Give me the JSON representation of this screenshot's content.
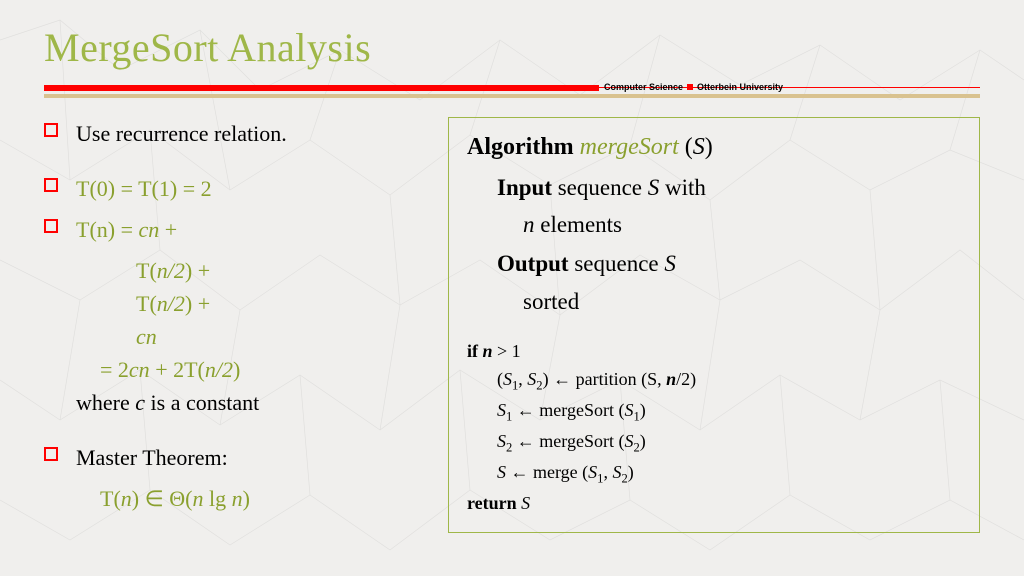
{
  "title": "MergeSort Analysis",
  "footer": {
    "left": "Computer Science",
    "right": "Otterbein University"
  },
  "bullets": {
    "b1": "Use recurrence relation.",
    "b2": "T(0) = T(1) = 2",
    "b3_l1_a": "T(n) = ",
    "b3_l1_b": "cn",
    "b3_l1_c": " +",
    "b3_l2_a": "T(",
    "b3_l2_b": "n/2",
    "b3_l2_c": ") +",
    "b3_l3_a": "T(",
    "b3_l3_b": "n/2",
    "b3_l3_c": ") +",
    "b3_l4": "cn",
    "b3_l5_a": "= 2",
    "b3_l5_b": "cn",
    "b3_l5_c": " + 2T(",
    "b3_l5_d": "n/2",
    "b3_l5_e": ")",
    "b3_where_a": "where ",
    "b3_where_b": "c",
    "b3_where_c": " is a constant",
    "b4": "Master Theorem:",
    "b4_sub_a": "T(",
    "b4_sub_b": "n",
    "b4_sub_c": ") ∈ Θ(",
    "b4_sub_d": "n",
    "b4_sub_e": " lg ",
    "b4_sub_f": "n",
    "b4_sub_g": ")"
  },
  "algo": {
    "kw": "Algorithm",
    "name": "mergeSort",
    "arg_open": " (",
    "arg": "S",
    "arg_close": ")",
    "input_kw": "Input",
    "input_a": " sequence ",
    "input_b": "S",
    "input_c": " with",
    "input_d": "n",
    "input_e": " elements",
    "output_kw": "Output",
    "output_a": " sequence ",
    "output_b": "S",
    "output_c": "sorted",
    "code": {
      "if_kw": "if ",
      "if_n": "n",
      "if_rest": " > 1",
      "l1_a": "(",
      "l1_b": "S",
      "l1_c": ", ",
      "l1_d": "S",
      "l1_e": ") ← partition (S, ",
      "l1_f": "n",
      "l1_g": "/2)",
      "l2_a": "S",
      "l2_b": " ← mergeSort (",
      "l2_c": "S",
      "l2_d": ")",
      "l3_a": "S",
      "l3_b": " ← mergeSort (",
      "l3_c": "S",
      "l3_d": ")",
      "l4_a": "S",
      "l4_b": " ← merge (",
      "l4_c": "S",
      "l4_d": ", ",
      "l4_e": "S",
      "l4_f": ")",
      "ret_kw": "return ",
      "ret_v": "S"
    }
  }
}
